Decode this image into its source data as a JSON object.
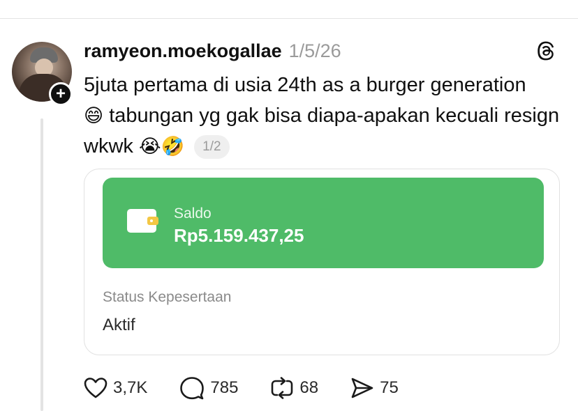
{
  "post": {
    "username": "ramyeon.moekogallae",
    "date": "1/5/26",
    "text_part1": "5juta pertama di usia 24th as a burger generation",
    "emoji_grin": "😄",
    "text_part2": " tabungan yg gak bisa diapa-apakan kecuali resign wkwk ",
    "emoji_cry": "😭",
    "emoji_rofl": "🤣",
    "pager": "1/2"
  },
  "card": {
    "saldo_label": "Saldo",
    "saldo_value": "Rp5.159.437,25",
    "status_label": "Status Kepesertaan",
    "status_value": "Aktif"
  },
  "actions": {
    "likes": "3,7K",
    "replies": "785",
    "reposts": "68",
    "shares": "75"
  },
  "colors": {
    "accent_green": "#4fbb68"
  },
  "icons": [
    "follow-plus-icon",
    "threads-logo-icon",
    "wallet-icon",
    "heart-icon",
    "comment-icon",
    "repost-icon",
    "share-icon"
  ]
}
